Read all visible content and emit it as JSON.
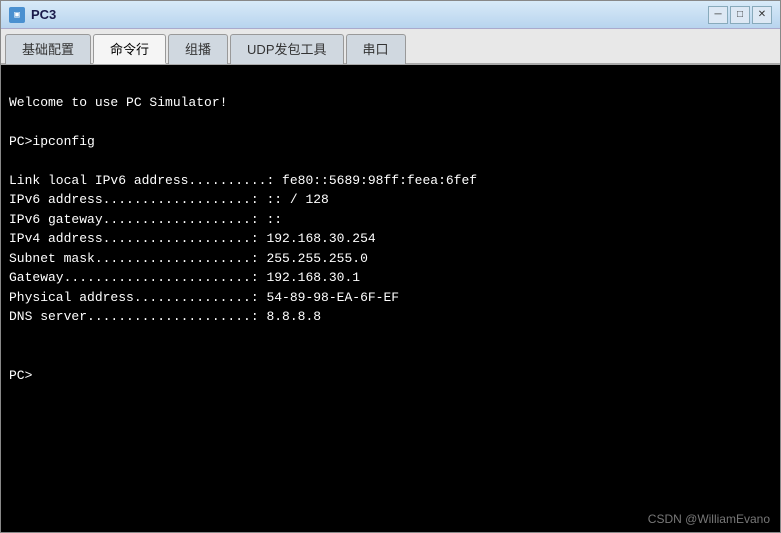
{
  "window": {
    "title": "PC3",
    "icon_label": "PC"
  },
  "tabs": [
    {
      "label": "基础配置",
      "active": false
    },
    {
      "label": "命令行",
      "active": true
    },
    {
      "label": "组播",
      "active": false
    },
    {
      "label": "UDP发包工具",
      "active": false
    },
    {
      "label": "串口",
      "active": false
    }
  ],
  "terminal": {
    "welcome_line": "Welcome to use PC Simulator!",
    "blank1": "",
    "command_line": "PC>ipconfig",
    "blank2": "",
    "line1_label": "Link local IPv6 address..........: ",
    "line1_value": "fe80::5689:98ff:feea:6fef",
    "line2_label": "IPv6 address...................: ",
    "line2_value": ":: / 128",
    "line3_label": "IPv6 gateway...................: ",
    "line3_value": "::",
    "line4_label": "IPv4 address...................: ",
    "line4_value": "192.168.30.254",
    "line5_label": "Subnet mask....................: ",
    "line5_value": "255.255.255.0",
    "line6_label": "Gateway........................: ",
    "line6_value": "192.168.30.1",
    "line7_label": "Physical address...............: ",
    "line7_value": "54-89-98-EA-6F-EF",
    "line8_label": "DNS server.....................: ",
    "line8_value": "8.8.8.8",
    "blank3": "",
    "blank4": "",
    "prompt": "PC>"
  },
  "watermark": "CSDN @WilliamEvano",
  "title_buttons": {
    "minimize": "─",
    "maximize": "□",
    "close": "✕"
  }
}
